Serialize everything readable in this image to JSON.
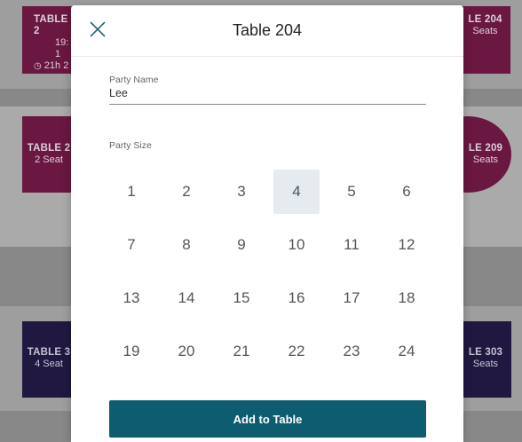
{
  "background": {
    "tiles": [
      {
        "line1": "TABLE 2",
        "line2": "19: 1",
        "line3": "21h 2"
      },
      {
        "line1": "LE 204",
        "line2": "Seats"
      },
      {
        "line1": "TABLE 2",
        "line2": "2 Seat"
      },
      {
        "line1": "LE 209",
        "line2": "Seats"
      },
      {
        "line1": "TABLE 3",
        "line2": "4 Seat"
      },
      {
        "line1": "LE 303",
        "line2": "Seats"
      }
    ],
    "colors": {
      "magenta": "#6e1442",
      "navy": "#1e1540"
    }
  },
  "modal": {
    "title": "Table 204",
    "close_icon": "close-icon",
    "party_name": {
      "label": "Party Name",
      "value": "Lee"
    },
    "party_size": {
      "label": "Party Size",
      "options": [
        "1",
        "2",
        "3",
        "4",
        "5",
        "6",
        "7",
        "8",
        "9",
        "10",
        "11",
        "12",
        "13",
        "14",
        "15",
        "16",
        "17",
        "18",
        "19",
        "20",
        "21",
        "22",
        "23",
        "24"
      ],
      "selected": "4"
    },
    "submit_label": "Add to Table",
    "accent_color": "#0d5c70"
  }
}
